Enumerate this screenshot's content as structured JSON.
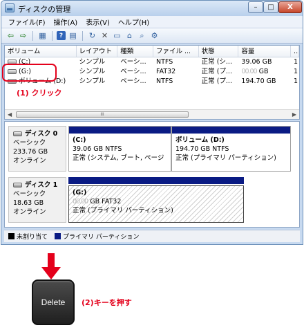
{
  "window": {
    "title": "ディスクの管理",
    "controls": {
      "minimize": "–",
      "maximize": "□",
      "close": "X"
    }
  },
  "menu": [
    "ファイル(F)",
    "操作(A)",
    "表示(V)",
    "ヘルプ(H)"
  ],
  "toolbar_icons": [
    "back-arrow-icon",
    "forward-arrow-icon",
    "console-icon",
    "help-icon",
    "properties-icon",
    "refresh-icon",
    "delete-icon",
    "folder-icon",
    "open-folder-icon",
    "search-icon",
    "settings-icon"
  ],
  "volume_list": {
    "columns": [
      "ボリューム",
      "レイアウト",
      "種類",
      "ファイル ...",
      "状態",
      "容量",
      "..."
    ],
    "rows": [
      {
        "volume": "(C:)",
        "layout": "シンプル",
        "type": "ベーシ...",
        "fs": "NTFS",
        "status": "正常 (シ...",
        "capacity": "39.06 GB",
        "extra": "1"
      },
      {
        "volume": "(G:)",
        "layout": "シンプル",
        "type": "ベーシ...",
        "fs": "FAT32",
        "status": "正常 (プ...",
        "capacity_blur": "00.00",
        "capacity_unit": "GB",
        "extra": "1"
      },
      {
        "volume": "ボリューム (D:)",
        "layout": "シンプル",
        "type": "ベーシ...",
        "fs": "NTFS",
        "status": "正常 (プ...",
        "capacity": "194.70 GB",
        "extra": "1"
      }
    ],
    "scroll_grip": "III"
  },
  "disks": [
    {
      "name": "ディスク 0",
      "kind": "ベーシック",
      "size": "233.76 GB",
      "state": "オンライン",
      "partitions": [
        {
          "name": "(C:)",
          "size": "39.06 GB NTFS",
          "status": "正常 (システム, ブート, ページ"
        },
        {
          "name": "ボリューム  (D:)",
          "size": "194.70 GB NTFS",
          "status": "正常 (プライマリ パーティション)"
        }
      ]
    },
    {
      "name": "ディスク 1",
      "kind": "ベーシック",
      "size": "18.63 GB",
      "state": "オンライン",
      "partitions": [
        {
          "name": "(G:)",
          "size_blur": "00.00",
          "size_rest": "GB FAT32",
          "status": "正常 (プライマリ パーティション)"
        }
      ]
    }
  ],
  "legend": [
    {
      "label": "未割り当て",
      "color": "#000000"
    },
    {
      "label": "プライマリ パーティション",
      "color": "#0a1b84"
    }
  ],
  "annotations": {
    "step1": "(1) クリック",
    "step2": "(2)キーを押す",
    "key_label": "Delete",
    "accent": "#e4001b"
  }
}
